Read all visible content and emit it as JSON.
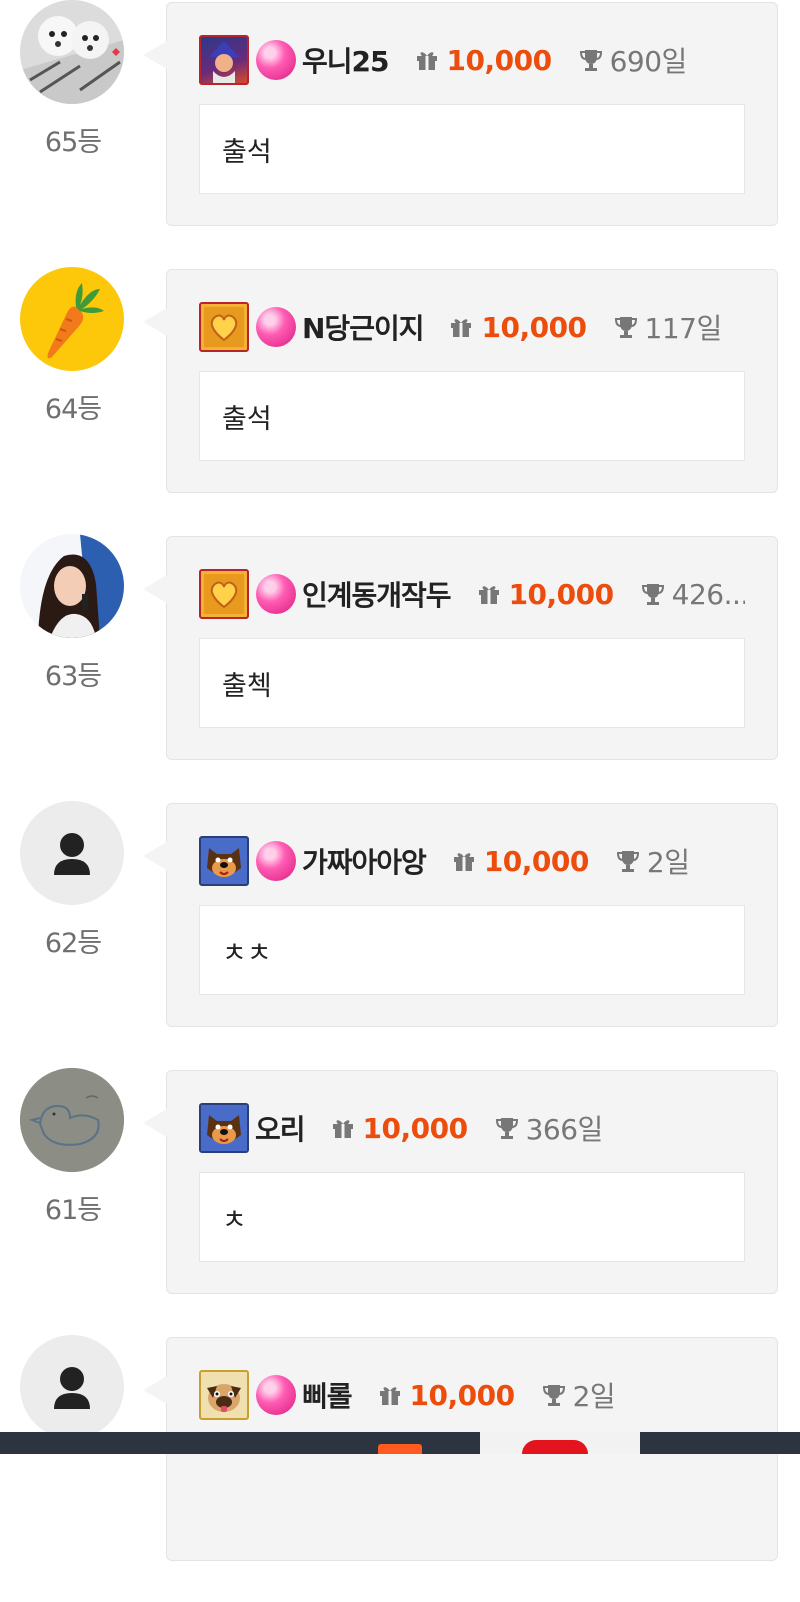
{
  "entries": [
    {
      "rank": "65등",
      "nickname": "우니25",
      "gift": "10,000",
      "days": "690일",
      "message": "출석",
      "has_gem": true,
      "avatar": "puppy-photo",
      "level_icon": "wizard"
    },
    {
      "rank": "64등",
      "nickname": "N당근이지",
      "gift": "10,000",
      "days": "117일",
      "message": "출석",
      "has_gem": true,
      "avatar": "carrot",
      "level_icon": "golden-heart"
    },
    {
      "rank": "63등",
      "nickname": "인계동개작두",
      "gift": "10,000",
      "days": "426...",
      "message": "출첵",
      "has_gem": true,
      "avatar": "singer-photo",
      "level_icon": "golden-heart"
    },
    {
      "rank": "62등",
      "nickname": "가짜아아앙",
      "gift": "10,000",
      "days": "2일",
      "message": "ㅊㅊ",
      "has_gem": true,
      "avatar": "default-user",
      "level_icon": "dog"
    },
    {
      "rank": "61등",
      "nickname": "오리",
      "gift": "10,000",
      "days": "366일",
      "message": "ㅊ",
      "has_gem": false,
      "avatar": "duck-sketch",
      "level_icon": "dog"
    },
    {
      "rank": "",
      "nickname": "삐롤",
      "gift": "10,000",
      "days": "2일",
      "message": "",
      "has_gem": true,
      "avatar": "default-user",
      "level_icon": "pug"
    }
  ],
  "colors": {
    "accent": "#ec4d0c",
    "bubble": "#f4f4f4",
    "bottom_bar": "#2c3440"
  },
  "icons": {
    "gift": "gift-icon",
    "trophy": "trophy-icon",
    "gem": "pink-gem-icon"
  }
}
